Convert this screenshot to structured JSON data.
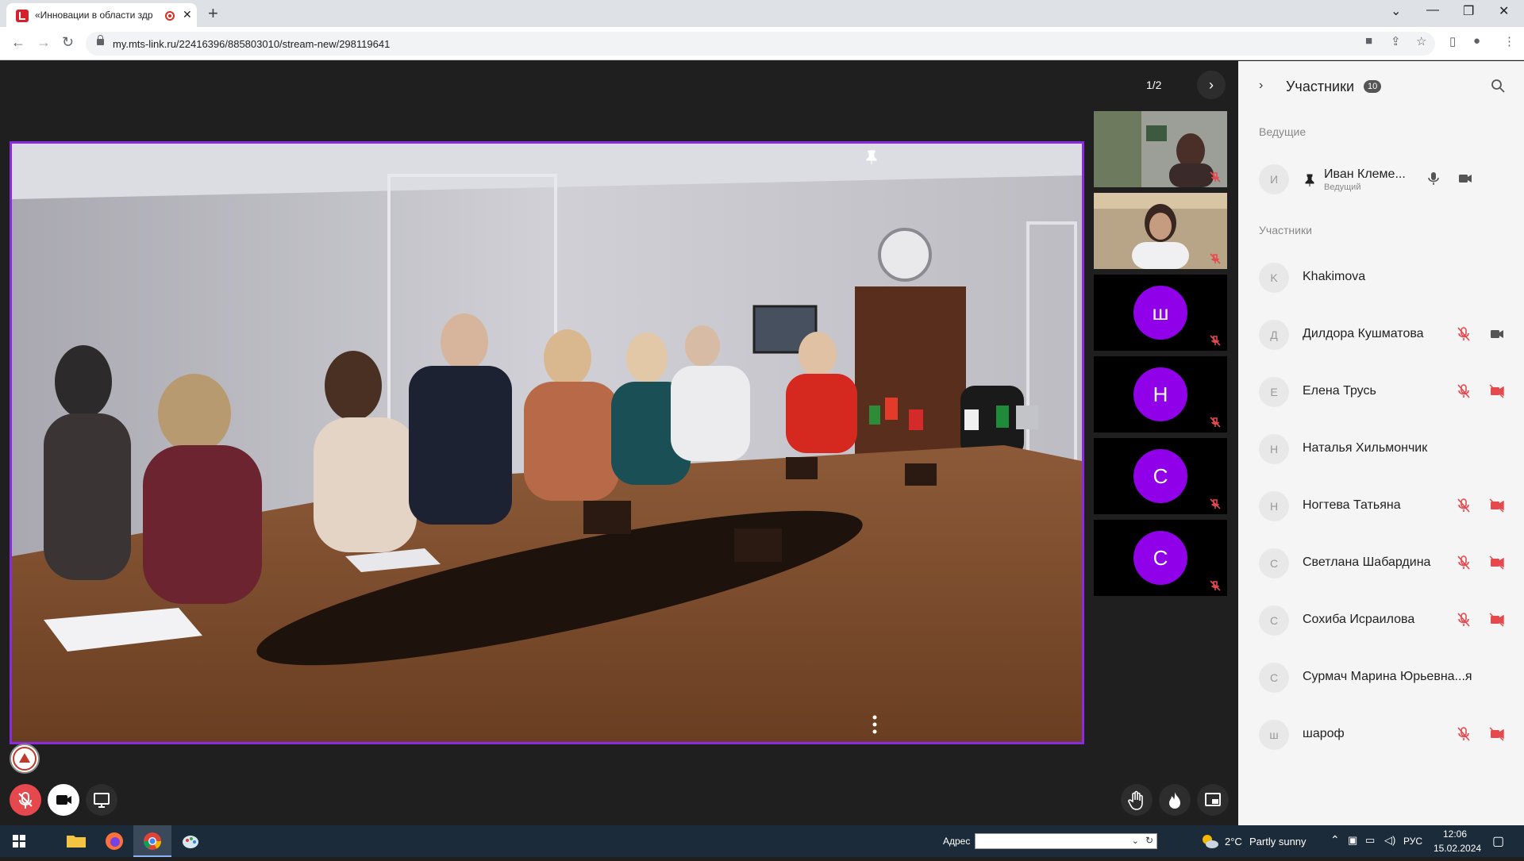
{
  "browser": {
    "tab_title": "«Инновации в области здр",
    "url": "my.mts-link.ru/22416396/885803010/stream-new/298119641"
  },
  "stage": {
    "pager": "1/2"
  },
  "tiles": [
    {
      "type": "video"
    },
    {
      "type": "video"
    },
    {
      "type": "avatar",
      "initial": "ш"
    },
    {
      "type": "avatar",
      "initial": "Н"
    },
    {
      "type": "avatar",
      "initial": "С"
    },
    {
      "type": "avatar",
      "initial": "С"
    }
  ],
  "panel": {
    "title": "Участники",
    "count": "10",
    "hosts_label": "Ведущие",
    "participants_label": "Участники",
    "host": {
      "initial": "И",
      "name": "Иван Клеме...",
      "role": "Ведущий"
    },
    "participants": [
      {
        "initial": "K",
        "name": "Khakimova",
        "mic": "none",
        "cam": "none"
      },
      {
        "initial": "Д",
        "name": "Дилдора Кушматова",
        "mic": "off",
        "cam": "on"
      },
      {
        "initial": "Е",
        "name": "Елена Трусь",
        "mic": "off",
        "cam": "off"
      },
      {
        "initial": "Н",
        "name": "Наталья Хильмончик",
        "mic": "none",
        "cam": "none"
      },
      {
        "initial": "Н",
        "name": "Ногтева Татьяна",
        "mic": "off",
        "cam": "off"
      },
      {
        "initial": "С",
        "name": "Светлана Шабардина",
        "mic": "off",
        "cam": "off"
      },
      {
        "initial": "С",
        "name": "Сохиба Исраилова",
        "mic": "off",
        "cam": "off"
      },
      {
        "initial": "С",
        "name": "Сурмач Марина Юрьевна...я",
        "mic": "none",
        "cam": "none"
      },
      {
        "initial": "ш",
        "name": "шароф",
        "mic": "off",
        "cam": "off"
      }
    ]
  },
  "taskbar": {
    "address_label": "Адрес",
    "weather_temp": "2°C",
    "weather_text": "Partly sunny",
    "lang": "РУС",
    "time": "12:06",
    "date": "15.02.2024"
  },
  "colors": {
    "accent": "#8a2be2",
    "avatar": "#9000e8",
    "muted": "#e5484d"
  }
}
